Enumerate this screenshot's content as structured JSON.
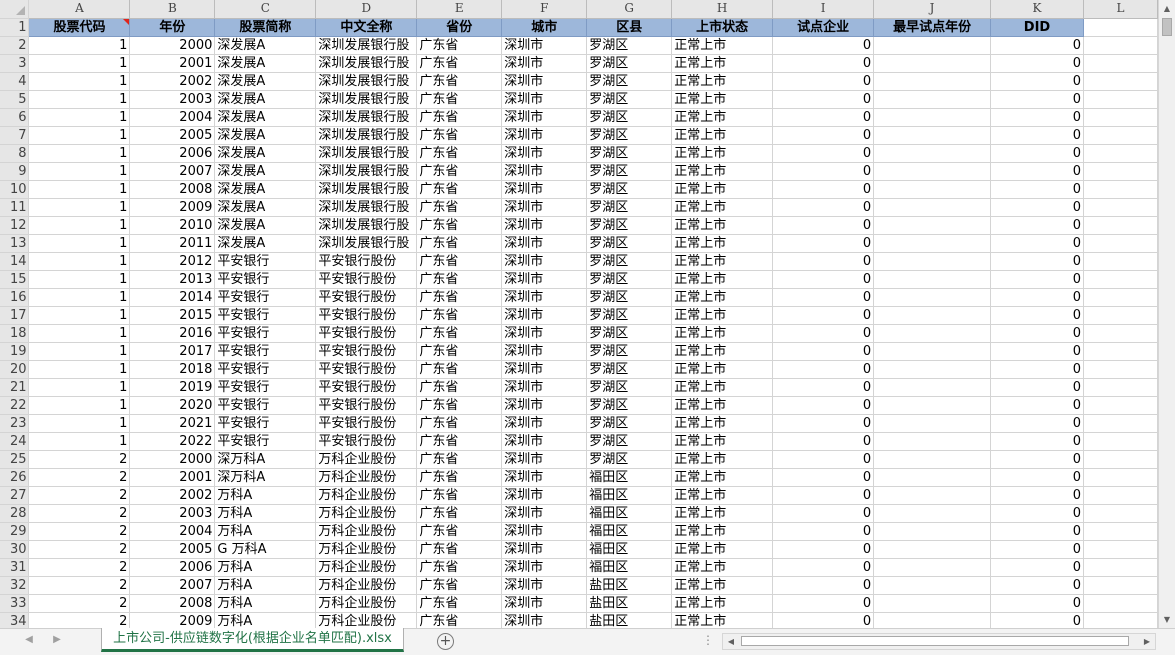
{
  "columns": [
    "A",
    "B",
    "C",
    "D",
    "E",
    "F",
    "G",
    "H",
    "I",
    "J",
    "K",
    "L"
  ],
  "headers": [
    "股票代码",
    "年份",
    "股票简称",
    "中文全称",
    "省份",
    "城市",
    "区县",
    "上市状态",
    "试点企业",
    "最早试点年份",
    "DID"
  ],
  "rows": [
    [
      "2",
      "1",
      "2000",
      "深发展A",
      "深圳发展银行股",
      "广东省",
      "深圳市",
      "罗湖区",
      "正常上市",
      "0",
      "",
      "0"
    ],
    [
      "3",
      "1",
      "2001",
      "深发展A",
      "深圳发展银行股",
      "广东省",
      "深圳市",
      "罗湖区",
      "正常上市",
      "0",
      "",
      "0"
    ],
    [
      "4",
      "1",
      "2002",
      "深发展A",
      "深圳发展银行股",
      "广东省",
      "深圳市",
      "罗湖区",
      "正常上市",
      "0",
      "",
      "0"
    ],
    [
      "5",
      "1",
      "2003",
      "深发展A",
      "深圳发展银行股",
      "广东省",
      "深圳市",
      "罗湖区",
      "正常上市",
      "0",
      "",
      "0"
    ],
    [
      "6",
      "1",
      "2004",
      "深发展A",
      "深圳发展银行股",
      "广东省",
      "深圳市",
      "罗湖区",
      "正常上市",
      "0",
      "",
      "0"
    ],
    [
      "7",
      "1",
      "2005",
      "深发展A",
      "深圳发展银行股",
      "广东省",
      "深圳市",
      "罗湖区",
      "正常上市",
      "0",
      "",
      "0"
    ],
    [
      "8",
      "1",
      "2006",
      "深发展A",
      "深圳发展银行股",
      "广东省",
      "深圳市",
      "罗湖区",
      "正常上市",
      "0",
      "",
      "0"
    ],
    [
      "9",
      "1",
      "2007",
      "深发展A",
      "深圳发展银行股",
      "广东省",
      "深圳市",
      "罗湖区",
      "正常上市",
      "0",
      "",
      "0"
    ],
    [
      "10",
      "1",
      "2008",
      "深发展A",
      "深圳发展银行股",
      "广东省",
      "深圳市",
      "罗湖区",
      "正常上市",
      "0",
      "",
      "0"
    ],
    [
      "11",
      "1",
      "2009",
      "深发展A",
      "深圳发展银行股",
      "广东省",
      "深圳市",
      "罗湖区",
      "正常上市",
      "0",
      "",
      "0"
    ],
    [
      "12",
      "1",
      "2010",
      "深发展A",
      "深圳发展银行股",
      "广东省",
      "深圳市",
      "罗湖区",
      "正常上市",
      "0",
      "",
      "0"
    ],
    [
      "13",
      "1",
      "2011",
      "深发展A",
      "深圳发展银行股",
      "广东省",
      "深圳市",
      "罗湖区",
      "正常上市",
      "0",
      "",
      "0"
    ],
    [
      "14",
      "1",
      "2012",
      "平安银行",
      "平安银行股份",
      "广东省",
      "深圳市",
      "罗湖区",
      "正常上市",
      "0",
      "",
      "0"
    ],
    [
      "15",
      "1",
      "2013",
      "平安银行",
      "平安银行股份",
      "广东省",
      "深圳市",
      "罗湖区",
      "正常上市",
      "0",
      "",
      "0"
    ],
    [
      "16",
      "1",
      "2014",
      "平安银行",
      "平安银行股份",
      "广东省",
      "深圳市",
      "罗湖区",
      "正常上市",
      "0",
      "",
      "0"
    ],
    [
      "17",
      "1",
      "2015",
      "平安银行",
      "平安银行股份",
      "广东省",
      "深圳市",
      "罗湖区",
      "正常上市",
      "0",
      "",
      "0"
    ],
    [
      "18",
      "1",
      "2016",
      "平安银行",
      "平安银行股份",
      "广东省",
      "深圳市",
      "罗湖区",
      "正常上市",
      "0",
      "",
      "0"
    ],
    [
      "19",
      "1",
      "2017",
      "平安银行",
      "平安银行股份",
      "广东省",
      "深圳市",
      "罗湖区",
      "正常上市",
      "0",
      "",
      "0"
    ],
    [
      "20",
      "1",
      "2018",
      "平安银行",
      "平安银行股份",
      "广东省",
      "深圳市",
      "罗湖区",
      "正常上市",
      "0",
      "",
      "0"
    ],
    [
      "21",
      "1",
      "2019",
      "平安银行",
      "平安银行股份",
      "广东省",
      "深圳市",
      "罗湖区",
      "正常上市",
      "0",
      "",
      "0"
    ],
    [
      "22",
      "1",
      "2020",
      "平安银行",
      "平安银行股份",
      "广东省",
      "深圳市",
      "罗湖区",
      "正常上市",
      "0",
      "",
      "0"
    ],
    [
      "23",
      "1",
      "2021",
      "平安银行",
      "平安银行股份",
      "广东省",
      "深圳市",
      "罗湖区",
      "正常上市",
      "0",
      "",
      "0"
    ],
    [
      "24",
      "1",
      "2022",
      "平安银行",
      "平安银行股份",
      "广东省",
      "深圳市",
      "罗湖区",
      "正常上市",
      "0",
      "",
      "0"
    ],
    [
      "25",
      "2",
      "2000",
      "深万科A",
      "万科企业股份",
      "广东省",
      "深圳市",
      "罗湖区",
      "正常上市",
      "0",
      "",
      "0"
    ],
    [
      "26",
      "2",
      "2001",
      "深万科A",
      "万科企业股份",
      "广东省",
      "深圳市",
      "福田区",
      "正常上市",
      "0",
      "",
      "0"
    ],
    [
      "27",
      "2",
      "2002",
      "万科A",
      "万科企业股份",
      "广东省",
      "深圳市",
      "福田区",
      "正常上市",
      "0",
      "",
      "0"
    ],
    [
      "28",
      "2",
      "2003",
      "万科A",
      "万科企业股份",
      "广东省",
      "深圳市",
      "福田区",
      "正常上市",
      "0",
      "",
      "0"
    ],
    [
      "29",
      "2",
      "2004",
      "万科A",
      "万科企业股份",
      "广东省",
      "深圳市",
      "福田区",
      "正常上市",
      "0",
      "",
      "0"
    ],
    [
      "30",
      "2",
      "2005",
      "G 万科A",
      "万科企业股份",
      "广东省",
      "深圳市",
      "福田区",
      "正常上市",
      "0",
      "",
      "0"
    ],
    [
      "31",
      "2",
      "2006",
      "万科A",
      "万科企业股份",
      "广东省",
      "深圳市",
      "福田区",
      "正常上市",
      "0",
      "",
      "0"
    ],
    [
      "32",
      "2",
      "2007",
      "万科A",
      "万科企业股份",
      "广东省",
      "深圳市",
      "盐田区",
      "正常上市",
      "0",
      "",
      "0"
    ],
    [
      "33",
      "2",
      "2008",
      "万科A",
      "万科企业股份",
      "广东省",
      "深圳市",
      "盐田区",
      "正常上市",
      "0",
      "",
      "0"
    ],
    [
      "34",
      "2",
      "2009",
      "万科A",
      "万科企业股份",
      "广东省",
      "深圳市",
      "盐田区",
      "正常上市",
      "0",
      "",
      "0"
    ]
  ],
  "sheet_tab": "上市公司-供应链数字化(根据企业名单匹配).xlsx",
  "icons": {
    "add_sheet": "+",
    "tab_prev": "◀",
    "tab_next": "▶",
    "split_handle": "⋮",
    "scroll_up": "▲",
    "scroll_down": "▼",
    "scroll_left": "◀",
    "scroll_right": "▶"
  },
  "colors": {
    "header_fill": "#9db7da",
    "sheet_tab_accent": "#217346",
    "comment_marker": "#e0251b"
  }
}
